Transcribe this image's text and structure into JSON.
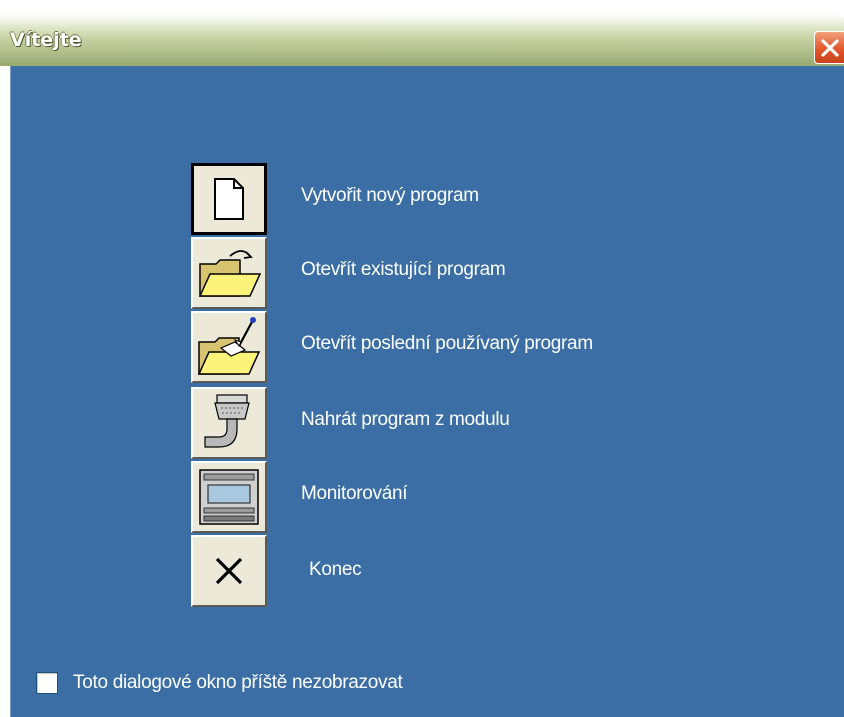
{
  "window": {
    "title": "Vítejte"
  },
  "menu": {
    "items": [
      {
        "label": "Vytvořit nový program",
        "icon": "new-document-icon"
      },
      {
        "label": "Otevřít existující program",
        "icon": "open-folder-icon"
      },
      {
        "label": "Otevřít poslední používaný program",
        "icon": "recent-folder-icon"
      },
      {
        "label": "Nahrát program z modulu",
        "icon": "upload-cable-icon"
      },
      {
        "label": "Monitorování",
        "icon": "monitor-device-icon"
      },
      {
        "label": "Konec",
        "icon": "exit-x-icon"
      }
    ]
  },
  "footer": {
    "checkbox_label": "Toto dialogové okno příště nezobrazovat",
    "checked": false
  },
  "colors": {
    "client_bg": "#3a6ea5",
    "titlebar": "#98a870",
    "close": "#e2572a",
    "button_face": "#ece9d8"
  }
}
